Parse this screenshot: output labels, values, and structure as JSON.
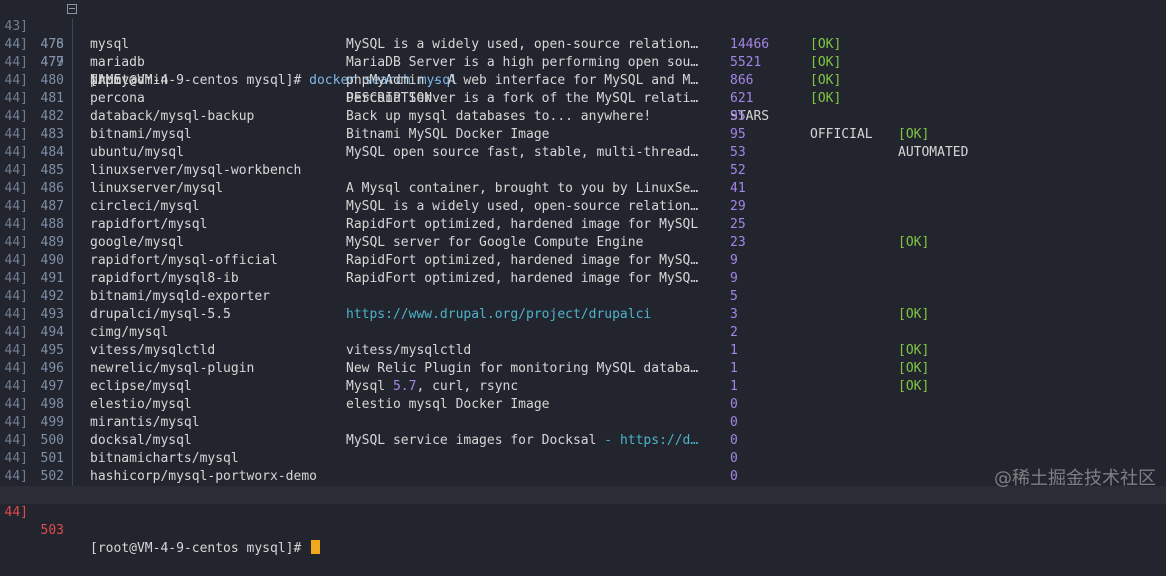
{
  "top_line": {
    "gutter": "43]",
    "line_no": "476",
    "prompt": "[root@VM-4-9-centos mysql]#",
    "command": "docker search mysql"
  },
  "header": {
    "gutter": "44]",
    "line_no": "477",
    "name": "NAME",
    "description": "DESCRIPTION",
    "stars": "STARS",
    "official": "OFFICIAL",
    "automated": "AUTOMATED"
  },
  "rows": [
    {
      "gutter": "44]",
      "line_no": "478",
      "name": "mysql",
      "description": "MySQL is a widely used, open-source relation…",
      "stars": "14466",
      "official": "[OK]",
      "automated": ""
    },
    {
      "gutter": "44]",
      "line_no": "479",
      "name": "mariadb",
      "description": "MariaDB Server is a high performing open sou…",
      "stars": "5521",
      "official": "[OK]",
      "automated": ""
    },
    {
      "gutter": "44]",
      "line_no": "480",
      "name": "phpmyadmin",
      "description": "phpMyAdmin - A web interface for MySQL and M…",
      "stars": "866",
      "official": "[OK]",
      "automated": ""
    },
    {
      "gutter": "44]",
      "line_no": "481",
      "name": "percona",
      "description": "Percona Server is a fork of the MySQL relati…",
      "stars": "621",
      "official": "[OK]",
      "automated": ""
    },
    {
      "gutter": "44]",
      "line_no": "482",
      "name": "databack/mysql-backup",
      "description": "Back up mysql databases to... anywhere!",
      "stars": "95",
      "official": "",
      "automated": ""
    },
    {
      "gutter": "44]",
      "line_no": "483",
      "name": "bitnami/mysql",
      "description": "Bitnami MySQL Docker Image",
      "stars": "95",
      "official": "",
      "automated": "[OK]"
    },
    {
      "gutter": "44]",
      "line_no": "484",
      "name": "ubuntu/mysql",
      "description": "MySQL open source fast, stable, multi-thread…",
      "stars": "53",
      "official": "",
      "automated": ""
    },
    {
      "gutter": "44]",
      "line_no": "485",
      "name": "linuxserver/mysql-workbench",
      "description": "",
      "stars": "52",
      "official": "",
      "automated": ""
    },
    {
      "gutter": "44]",
      "line_no": "486",
      "name": "linuxserver/mysql",
      "description": "A Mysql container, brought to you by LinuxSe…",
      "stars": "41",
      "official": "",
      "automated": ""
    },
    {
      "gutter": "44]",
      "line_no": "487",
      "name": "circleci/mysql",
      "description": "MySQL is a widely used, open-source relation…",
      "stars": "29",
      "official": "",
      "automated": ""
    },
    {
      "gutter": "44]",
      "line_no": "488",
      "name": "rapidfort/mysql",
      "description": "RapidFort optimized, hardened image for MySQL",
      "stars": "25",
      "official": "",
      "automated": ""
    },
    {
      "gutter": "44]",
      "line_no": "489",
      "name": "google/mysql",
      "description": "MySQL server for Google Compute Engine",
      "stars": "23",
      "official": "",
      "automated": "[OK]"
    },
    {
      "gutter": "44]",
      "line_no": "490",
      "name": "rapidfort/mysql-official",
      "description": "RapidFort optimized, hardened image for MySQ…",
      "stars": "9",
      "official": "",
      "automated": ""
    },
    {
      "gutter": "44]",
      "line_no": "491",
      "name": "rapidfort/mysql8-ib",
      "description": "RapidFort optimized, hardened image for MySQ…",
      "stars": "9",
      "official": "",
      "automated": ""
    },
    {
      "gutter": "44]",
      "line_no": "492",
      "name": "bitnami/mysqld-exporter",
      "description": "",
      "stars": "5",
      "official": "",
      "automated": ""
    },
    {
      "gutter": "44]",
      "line_no": "493",
      "name": "drupalci/mysql-5.5",
      "description": "https://www.drupal.org/project/drupalci",
      "stars": "3",
      "official": "",
      "automated": "[OK]"
    },
    {
      "gutter": "44]",
      "line_no": "494",
      "name": "cimg/mysql",
      "description": "",
      "stars": "2",
      "official": "",
      "automated": ""
    },
    {
      "gutter": "44]",
      "line_no": "495",
      "name": "vitess/mysqlctld",
      "description": "vitess/mysqlctld",
      "stars": "1",
      "official": "",
      "automated": "[OK]"
    },
    {
      "gutter": "44]",
      "line_no": "496",
      "name": "newrelic/mysql-plugin",
      "description": "New Relic Plugin for monitoring MySQL databa…",
      "stars": "1",
      "official": "",
      "automated": "[OK]"
    },
    {
      "gutter": "44]",
      "line_no": "497",
      "name": "eclipse/mysql",
      "description": "Mysql 5.7, curl, rsync",
      "stars": "1",
      "official": "",
      "automated": "[OK]"
    },
    {
      "gutter": "44]",
      "line_no": "498",
      "name": "elestio/mysql",
      "description": "elestio mysql Docker Image",
      "stars": "0",
      "official": "",
      "automated": ""
    },
    {
      "gutter": "44]",
      "line_no": "499",
      "name": "mirantis/mysql",
      "description": "",
      "stars": "0",
      "official": "",
      "automated": ""
    },
    {
      "gutter": "44]",
      "line_no": "500",
      "name": "docksal/mysql",
      "description": "MySQL service images for Docksal - https://d…",
      "stars": "0",
      "official": "",
      "automated": ""
    },
    {
      "gutter": "44]",
      "line_no": "501",
      "name": "bitnamicharts/mysql",
      "description": "",
      "stars": "0",
      "official": "",
      "automated": ""
    },
    {
      "gutter": "44]",
      "line_no": "502",
      "name": "hashicorp/mysql-portworx-demo",
      "description": "",
      "stars": "0",
      "official": "",
      "automated": ""
    }
  ],
  "bottom_line": {
    "gutter": "44]",
    "line_no": "503",
    "prompt": "[root@VM-4-9-centos mysql]#"
  },
  "watermark": "@稀土掘金技术社区",
  "colors": {
    "background": "#23252e",
    "stars": "#a385e6",
    "ok": "#7fc743",
    "url": "#4cb2c9",
    "cursor": "#f2a81d",
    "current_line_no": "#e04b4b"
  }
}
